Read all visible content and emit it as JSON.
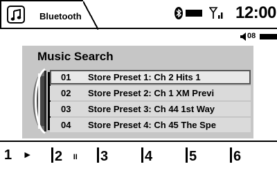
{
  "status_bar": {
    "source_label": "Bluetooth",
    "clock": "12:00"
  },
  "icons": {
    "app_icon": "music-note-icon",
    "bluetooth": "bluetooth-icon",
    "battery": "battery-icon",
    "signal": "signal-strength-icon",
    "speaker": "speaker-icon",
    "knob": "tuning-knob-icon"
  },
  "volume": {
    "value": "08"
  },
  "panel": {
    "title": "Music Search",
    "presets": [
      {
        "num": "01",
        "name": "Store Preset 1: Ch 2 Hits 1",
        "selected": true
      },
      {
        "num": "02",
        "name": "Store Preset 2: Ch 1 XM Previ",
        "selected": false
      },
      {
        "num": "03",
        "name": "Store Preset 3: Ch 44 1st Way",
        "selected": false
      },
      {
        "num": "04",
        "name": "Store Preset 4: Ch 45 The Spe",
        "selected": false
      }
    ]
  },
  "bottom_bar": {
    "slots": [
      {
        "num": "1",
        "symbol": "►"
      },
      {
        "num": "2",
        "symbol": "II"
      },
      {
        "num": "3",
        "symbol": ""
      },
      {
        "num": "4",
        "symbol": ""
      },
      {
        "num": "5",
        "symbol": ""
      },
      {
        "num": "6",
        "symbol": ""
      }
    ]
  },
  "colors": {
    "panel_background": "#c6c6c6",
    "row_background": "#dadada",
    "selected_row_border": "#555555"
  }
}
